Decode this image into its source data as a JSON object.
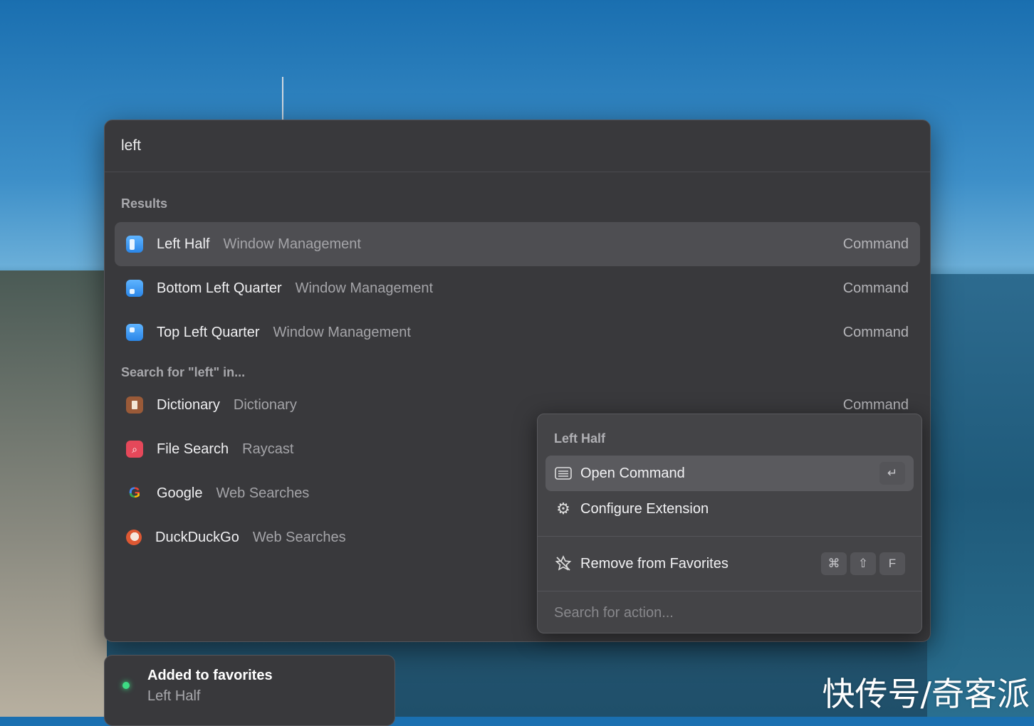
{
  "search": {
    "query": "left"
  },
  "sections": [
    {
      "title": "Results",
      "items": [
        {
          "title": "Left Half",
          "subtitle": "Window Management",
          "accessory": "Command",
          "icon": "left-half-icon",
          "selected": true
        },
        {
          "title": "Bottom Left Quarter",
          "subtitle": "Window Management",
          "accessory": "Command",
          "icon": "bottom-left-quarter-icon"
        },
        {
          "title": "Top Left Quarter",
          "subtitle": "Window Management",
          "accessory": "Command",
          "icon": "top-left-quarter-icon"
        }
      ]
    },
    {
      "title": "Search for \"left\" in...",
      "items": [
        {
          "title": "Dictionary",
          "subtitle": "Dictionary",
          "accessory": "Command",
          "icon": "dictionary-icon"
        },
        {
          "title": "File Search",
          "subtitle": "Raycast",
          "icon": "file-search-icon"
        },
        {
          "title": "Google",
          "subtitle": "Web Searches",
          "icon": "google-icon"
        },
        {
          "title": "DuckDuckGo",
          "subtitle": "Web Searches",
          "icon": "duckduckgo-icon"
        }
      ]
    }
  ],
  "action_panel": {
    "title": "Left Half",
    "actions": [
      {
        "label": "Open Command",
        "icon": "window-icon",
        "shortcut": [
          "↵"
        ],
        "selected": true
      },
      {
        "label": "Configure Extension",
        "icon": "gear-icon"
      },
      {
        "label": "Remove from Favorites",
        "icon": "star-slash-icon",
        "shortcut": [
          "⌘",
          "⇧",
          "F"
        ]
      }
    ],
    "search_placeholder": "Search for action..."
  },
  "toast": {
    "title": "Added to favorites",
    "subtitle": "Left Half",
    "status_color": "#3ddc84"
  },
  "watermark": "快传号/奇客派"
}
